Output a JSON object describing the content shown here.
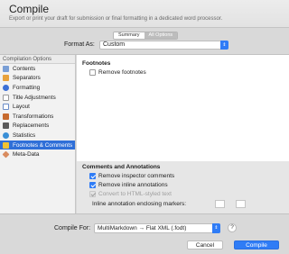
{
  "header": {
    "title": "Compile",
    "subtitle": "Export or print your draft for submission or final formatting in a dedicated word processor."
  },
  "tabs": [
    "Summary",
    "All Options"
  ],
  "format": {
    "label": "Format As:",
    "value": "Custom"
  },
  "sidebar": {
    "header": "Compilation Options",
    "items": [
      {
        "label": "Contents",
        "icon": "contents-icon",
        "color": "#7a9fd6"
      },
      {
        "label": "Separators",
        "icon": "separators-icon",
        "color": "#e8a23c"
      },
      {
        "label": "Formatting",
        "icon": "formatting-icon",
        "color": "#3a6fd6"
      },
      {
        "label": "Title Adjustments",
        "icon": "title-adjustments-icon",
        "color": "#9a9a9a"
      },
      {
        "label": "Layout",
        "icon": "layout-icon",
        "color": "#6a8cc7"
      },
      {
        "label": "Transformations",
        "icon": "transformations-icon",
        "color": "#c76a2e"
      },
      {
        "label": "Replacements",
        "icon": "replacements-icon",
        "color": "#5a5a5a"
      },
      {
        "label": "Statistics",
        "icon": "statistics-icon",
        "color": "#3a8fd6"
      },
      {
        "label": "Footnotes & Comments",
        "icon": "footnotes-icon",
        "color": "#f1c232"
      },
      {
        "label": "Meta-Data",
        "icon": "meta-data-icon",
        "color": "#d98c5f"
      }
    ],
    "selected_index": 8
  },
  "footnotes": {
    "heading": "Footnotes",
    "remove_footnotes": "Remove footnotes",
    "remove_footnotes_checked": false
  },
  "comments": {
    "heading": "Comments and Annotations",
    "remove_inspector": "Remove inspector comments",
    "remove_inline": "Remove inline annotations",
    "convert_html": "Convert to HTML-styled text",
    "inline_markers": "Inline annotation enclosing markers:"
  },
  "compile_for": {
    "label": "Compile For:",
    "value": "MultiMarkdown → Flat XML (.fodt)"
  },
  "buttons": {
    "help": "?",
    "cancel": "Cancel",
    "compile": "Compile"
  },
  "colors": {
    "accent": "#2f7cf6",
    "selection": "#2f6fd8"
  }
}
